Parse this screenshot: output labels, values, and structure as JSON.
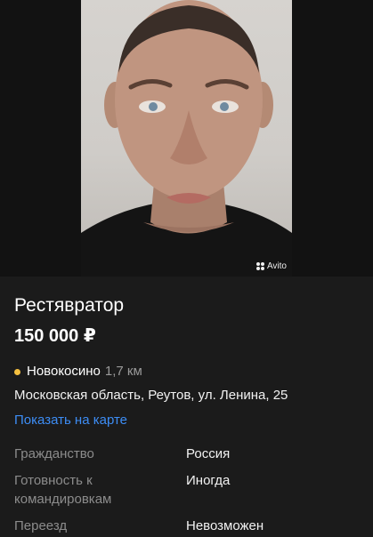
{
  "photo": {
    "watermark": "Avito",
    "watermark_icon": "avito-dots-icon"
  },
  "listing": {
    "title": "Рестявратор",
    "price": "150 000 ₽",
    "metro": {
      "station": "Новокосино",
      "distance": "1,7 км",
      "line_color": "#f5c040"
    },
    "address": "Московская область, Реутов, ул. Ленина, 25",
    "map_link": "Показать на карте"
  },
  "params": [
    {
      "label": "Гражданство",
      "value": "Россия"
    },
    {
      "label": "Готовность к командировкам",
      "value": "Иногда"
    },
    {
      "label": "Переезд",
      "value": "Невозможен"
    }
  ],
  "colors": {
    "background": "#1b1b1b",
    "link": "#3d8df5",
    "muted": "#8c8c8c"
  }
}
